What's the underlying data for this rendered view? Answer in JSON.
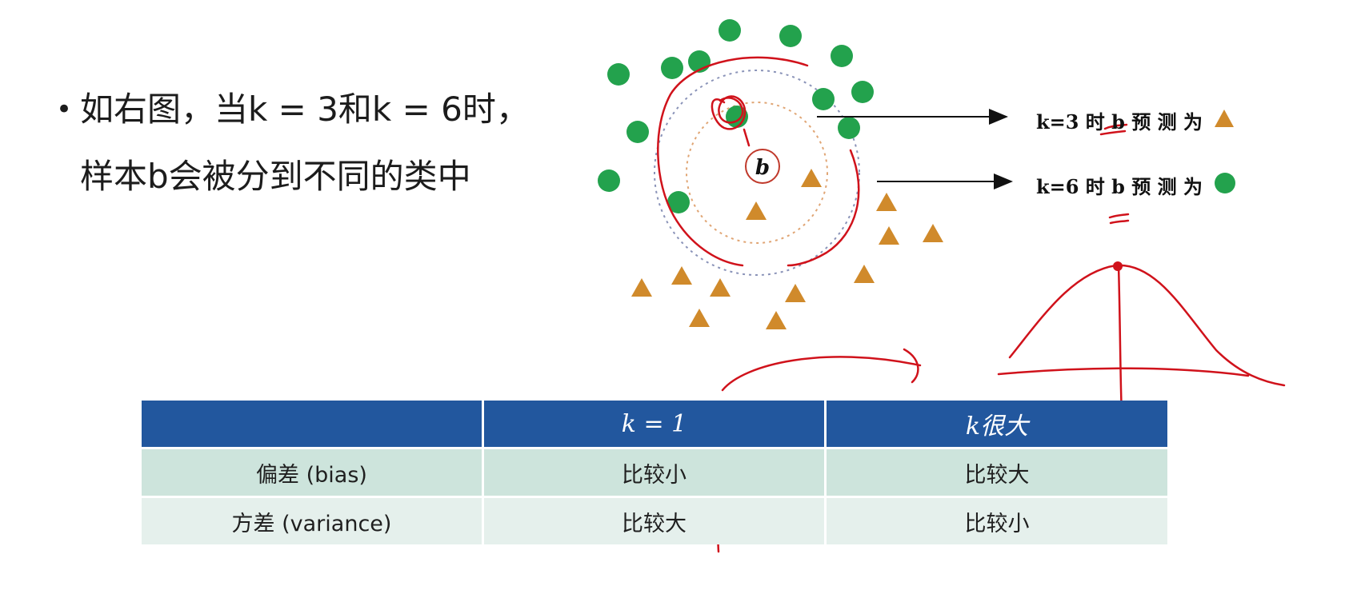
{
  "bullet": {
    "line1": "如右图，当k = 3和k = 6时，",
    "line2": "样本b会被分到不同的类中"
  },
  "diagram": {
    "sample_label": "b"
  },
  "legend": {
    "k3_text": "k=3 时 b 预 测 为",
    "k6_text": "k=6 时 b 预 测 为",
    "k3_symbol": "triangle",
    "k6_symbol": "circle"
  },
  "colors": {
    "green": "#23a24d",
    "orange": "#d08a2b",
    "red": "#d0121b",
    "table_header": "#22579e",
    "row_dark": "#cde4dc",
    "row_light": "#e5f0ec"
  },
  "table": {
    "headers": [
      "",
      "k = 1",
      "k很大"
    ],
    "rows": [
      [
        "偏差 (bias)",
        "比较小",
        "比较大"
      ],
      [
        "方差 (variance)",
        "比较大",
        "比较小"
      ]
    ]
  }
}
